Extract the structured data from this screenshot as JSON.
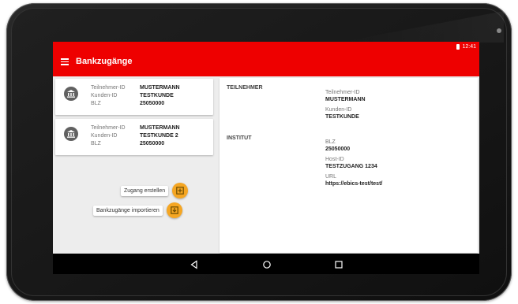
{
  "status": {
    "time": "12:41"
  },
  "appbar": {
    "title": "Bankzugänge"
  },
  "accounts": [
    {
      "labels": [
        "Teilnehmer-ID",
        "Kunden-ID",
        "BLZ"
      ],
      "values": [
        "MUSTERMANN",
        "TESTKUNDE",
        "25050000"
      ]
    },
    {
      "labels": [
        "Teilnehmer-ID",
        "Kunden-ID",
        "BLZ"
      ],
      "values": [
        "MUSTERMANN",
        "TESTKUNDE 2",
        "25050000"
      ]
    }
  ],
  "fab_menu": {
    "create_label": "Zugang erstellen",
    "import_label": "Bankzugänge importieren"
  },
  "detail": {
    "teilnehmer": {
      "heading": "TEILNEHMER",
      "fields": [
        {
          "label": "Teilnehmer-ID",
          "value": "MUSTERMANN"
        },
        {
          "label": "Kunden-ID",
          "value": "TESTKUNDE"
        }
      ]
    },
    "institut": {
      "heading": "INSTITUT",
      "fields": [
        {
          "label": "BLZ",
          "value": "25050000"
        },
        {
          "label": "Host-ID",
          "value": "TESTZUGANG 1234"
        },
        {
          "label": "URL",
          "value": "https://ebics-test/test/"
        }
      ]
    }
  },
  "colors": {
    "appbar": "#ee0000",
    "fab": "#f5a623"
  },
  "icons": [
    "menu-icon",
    "bank-icon",
    "add-box-icon",
    "import-icon",
    "close-icon",
    "back-icon",
    "home-icon",
    "recents-icon",
    "battery-icon"
  ]
}
